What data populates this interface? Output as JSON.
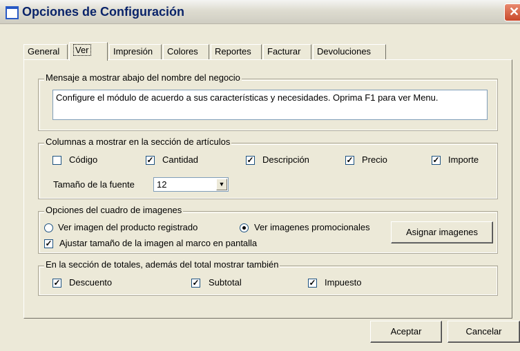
{
  "window": {
    "title": "Opciones de Configuración",
    "close_symbol": "✕"
  },
  "tabs": [
    "General",
    "Ver",
    "Impresión",
    "Colores",
    "Reportes",
    "Facturar",
    "Devoluciones"
  ],
  "active_tab": "Ver",
  "message_group": {
    "legend": "Mensaje a mostrar abajo del nombre del negocio",
    "text": "Configure el módulo de acuerdo a sus características y necesidades. Oprima F1 para ver Menu."
  },
  "columns_group": {
    "legend": "Columnas a mostrar en la sección de artículos",
    "items": [
      {
        "label": "Código",
        "checked": false
      },
      {
        "label": "Cantidad",
        "checked": true
      },
      {
        "label": "Descripción",
        "checked": true
      },
      {
        "label": "Precio",
        "checked": true
      },
      {
        "label": "Importe",
        "checked": true
      }
    ],
    "font_size_label": "Tamaño de la fuente",
    "font_size_value": "12"
  },
  "images_group": {
    "legend": "Opciones del cuadro de imagenes",
    "radio_product": "Ver imagen del producto registrado",
    "radio_promo": "Ver imagenes promocionales",
    "selected": "promo",
    "assign_button": "Asignar imagenes",
    "fit_checkbox": "Ajustar tamaño de la imagen al marco en pantalla",
    "fit_checked": true
  },
  "totals_group": {
    "legend": "En la sección de totales, además del total mostrar también",
    "items": [
      {
        "label": "Descuento",
        "checked": true
      },
      {
        "label": "Subtotal",
        "checked": true
      },
      {
        "label": "Impuesto",
        "checked": true
      }
    ]
  },
  "buttons": {
    "accept": "Aceptar",
    "cancel": "Cancelar"
  },
  "check_mark": "✓"
}
